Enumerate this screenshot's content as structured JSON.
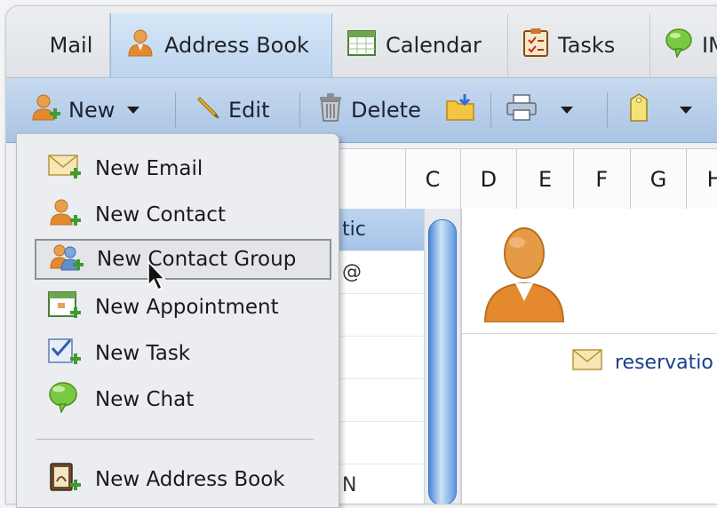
{
  "tabs": [
    {
      "label": "Mail",
      "icon": "mail-icon"
    },
    {
      "label": "Address Book",
      "icon": "address-book-icon",
      "active": true
    },
    {
      "label": "Calendar",
      "icon": "calendar-icon"
    },
    {
      "label": "Tasks",
      "icon": "tasks-icon"
    },
    {
      "label": "IM",
      "icon": "chat-bubble-icon"
    }
  ],
  "toolbar": {
    "new_label": "New",
    "edit_label": "Edit",
    "delete_label": "Delete"
  },
  "alphabet": [
    "",
    "C",
    "D",
    "E",
    "F",
    "G",
    "H"
  ],
  "contact_rows": [
    "tic",
    "@",
    "",
    "",
    "",
    "",
    "N"
  ],
  "detail": {
    "email": "reservatio"
  },
  "new_menu": {
    "items": [
      {
        "label": "New Email",
        "icon": "new-email-icon"
      },
      {
        "label": "New Contact",
        "icon": "new-contact-icon"
      },
      {
        "label": "New Contact Group",
        "icon": "new-contact-group-icon",
        "hovered": true
      },
      {
        "label": "New Appointment",
        "icon": "new-appointment-icon"
      },
      {
        "label": "New Task",
        "icon": "new-task-icon"
      },
      {
        "label": "New Chat",
        "icon": "new-chat-icon"
      },
      {
        "label": "New Address Book",
        "icon": "new-address-book-icon"
      }
    ]
  },
  "colors": {
    "active_tab": "#bcd5ef",
    "toolbar": "#b8cfe9",
    "link": "#1c3f8a",
    "selection": "#a6c4ea"
  }
}
